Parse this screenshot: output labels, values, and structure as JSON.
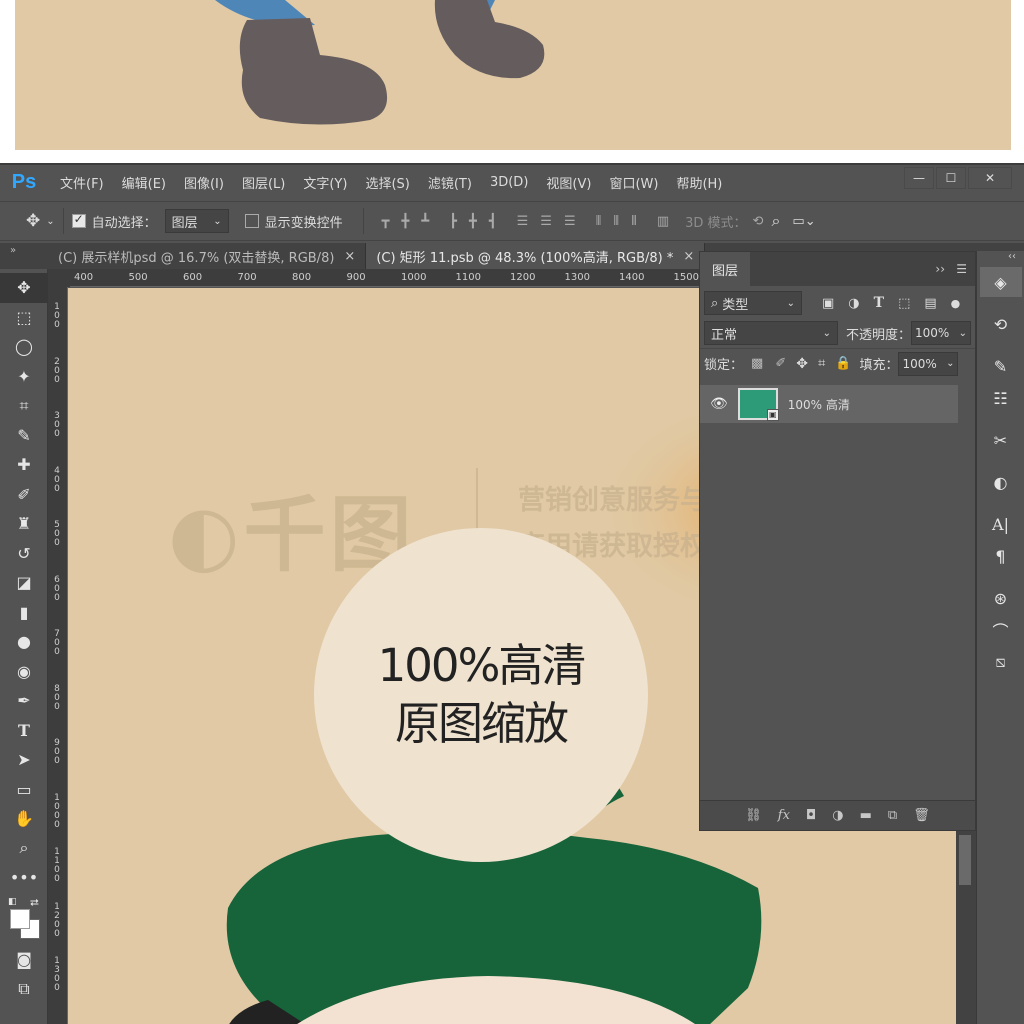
{
  "app": {
    "logo": "Ps"
  },
  "menu": [
    "文件(F)",
    "编辑(E)",
    "图像(I)",
    "图层(L)",
    "文字(Y)",
    "选择(S)",
    "滤镜(T)",
    "3D(D)",
    "视图(V)",
    "窗口(W)",
    "帮助(H)"
  ],
  "options": {
    "auto_select_label": "自动选择：",
    "auto_select_value": "图层",
    "show_transform_label": "显示变换控件",
    "mode_3d": "3D 模式："
  },
  "tabs": [
    {
      "label": "(C) 展示样机psd @ 16.7% (双击替换, RGB/8)",
      "close": "×"
    },
    {
      "label": "(C) 矩形 11.psb @ 48.3% (100%高清, RGB/8) *",
      "close": "×"
    }
  ],
  "ruler_top": [
    "400",
    "500",
    "600",
    "700",
    "800",
    "900",
    "1000",
    "1100",
    "1200",
    "1300",
    "1400",
    "1500"
  ],
  "ruler_left": [
    "100",
    "200",
    "300",
    "400",
    "500",
    "600",
    "700",
    "800",
    "900",
    "1000",
    "1100",
    "1200",
    "1300"
  ],
  "canvas": {
    "line1": "100%高清",
    "line2": "原图缩放",
    "watermark_brand": "千图",
    "watermark_line1": "营销创意服务与协作平台",
    "watermark_line2": "商用请获取授权",
    "colors": {
      "background": "#e0c9a4",
      "circle": "#efe2cf",
      "beret": "#17633a",
      "face": "#f3e2d2"
    }
  },
  "layers_panel": {
    "title": "图层",
    "filter_label": "类型",
    "blend_mode": "正常",
    "opacity_label": "不透明度：",
    "opacity_value": "100%",
    "lock_label": "锁定：",
    "fill_label": "填充：",
    "fill_value": "100%",
    "layer_name": "100% 高清",
    "layer_thumb_color": "#2e9b78"
  },
  "icons": [
    "move-tool-icon",
    "marquee-icon",
    "lasso-icon",
    "magic-wand-icon",
    "crop-icon",
    "eyedropper-icon",
    "healing-brush-icon",
    "brush-icon",
    "stamp-icon",
    "history-brush-icon",
    "eraser-icon",
    "gradient-icon",
    "blur-icon",
    "dodge-icon",
    "pen-icon",
    "type-icon",
    "path-select-icon",
    "rectangle-icon",
    "hand-icon",
    "zoom-icon",
    "more-tools-icon",
    "color-swatch-icon",
    "quick-mask-icon",
    "screen-mode-icon"
  ]
}
